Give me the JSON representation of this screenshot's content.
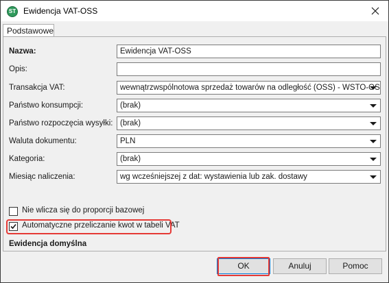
{
  "window": {
    "title": "Ewidencja VAT-OSS",
    "icon_text": "ST",
    "close_icon": "close-icon"
  },
  "tabs": [
    {
      "label": "Podstawowe",
      "active": true
    }
  ],
  "form": {
    "nazwa": {
      "label": "Nazwa:",
      "value": "Ewidencja VAT-OSS"
    },
    "opis": {
      "label": "Opis:",
      "value": ""
    },
    "transakcja": {
      "label": "Transakcja VAT:",
      "value": "wewnątrzwspólnotowa sprzedaż towarów na odległość (OSS) - WSTO-OSS"
    },
    "panstwo_konsumpcji": {
      "label": "Państwo konsumpcji:",
      "value": "(brak)"
    },
    "panstwo_rozpoczecia": {
      "label": "Państwo rozpoczęcia wysyłki:",
      "value": "(brak)"
    },
    "waluta": {
      "label": "Waluta dokumentu:",
      "value": "PLN"
    },
    "kategoria": {
      "label": "Kategoria:",
      "value": "(brak)"
    },
    "miesiac": {
      "label": "Miesiąc naliczenia:",
      "value": "wg wcześniejszej z dat: wystawienia lub zak. dostawy"
    }
  },
  "checkboxes": {
    "proporcja": {
      "label": "Nie wlicza się do proporcji bazowej",
      "checked": false
    },
    "przeliczanie": {
      "label": "Automatyczne przeliczanie kwot w tabeli VAT",
      "checked": true
    }
  },
  "section": {
    "ewidencja_domyslna": "Ewidencja domyślna"
  },
  "buttons": {
    "ok": "OK",
    "anuluj": "Anuluj",
    "pomoc": "Pomoc"
  },
  "colors": {
    "highlight": "#e53935",
    "icon": "#2f9a5c",
    "focus_border": "#0078d7"
  }
}
